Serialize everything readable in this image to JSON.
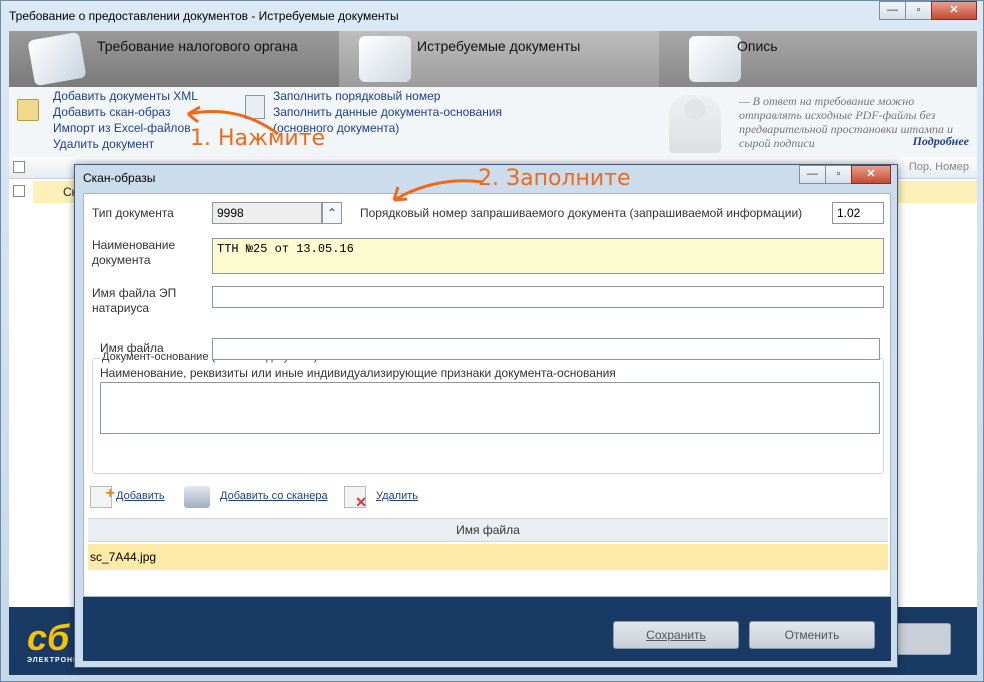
{
  "window": {
    "title": "Требование о предоставлении документов - Истребуемые документы",
    "controls": {
      "minimize": "—",
      "maximize": "▫",
      "close": "✕"
    }
  },
  "wizard": {
    "steps": [
      {
        "label": "Требование налогового органа",
        "icon": "tax-request-icon"
      },
      {
        "label": "Истребуемые документы",
        "icon": "documents-icon"
      },
      {
        "label": "Опись",
        "icon": "inventory-icon"
      }
    ]
  },
  "toolbar": {
    "add_xml": "Добавить документы XML",
    "add_scan": "Добавить скан-образ",
    "import_excel": "Импорт из Excel-файлов",
    "delete_doc": "Удалить документ",
    "fill_number": "Заполнить порядковый номер",
    "fill_base": "Заполнить данные документа-основания",
    "fill_base_sub": "(основного документа)",
    "hint": "— В ответ на требование можно отправлять исходные PDF-файлы без предварительной простановки штампа и сырой подписи",
    "more": "Подробнее"
  },
  "annotations": {
    "step1": "1. Нажмите",
    "step2": "2. Заполните"
  },
  "grid": {
    "col_number": "Пор. Номер",
    "row_text": "Ск"
  },
  "brand": {
    "logo": "сб",
    "tagline": "ЭЛЕКТРОННАЯ"
  },
  "dialog": {
    "title": "Скан-образы",
    "doc_type_label": "Тип документа",
    "doc_type_value": "9998",
    "order_label": "Порядковый номер запрашиваемого документа (запрашиваемой информации)",
    "order_value": "1.02",
    "doc_name_label": "Наименование документа",
    "doc_name_value": "ТТН №25 от 13.05.16",
    "notary_label": "Имя файла ЭП натариуса",
    "notary_value": "",
    "base_legend": "Документ-основание (основной документ)",
    "base_file_label": "Имя файла",
    "base_file_value": "",
    "base_details_label": "Наименование, реквизиты или иные индивидуализирующие признаки документа-основания",
    "base_details_value": "",
    "actions": {
      "add": "Добавить",
      "scanner": "Добавить со сканера",
      "delete": "Удалить"
    },
    "files_header": "Имя файла",
    "files": [
      "sc_7A44.jpg"
    ],
    "save": "Сохранить",
    "cancel": "Отменить"
  }
}
